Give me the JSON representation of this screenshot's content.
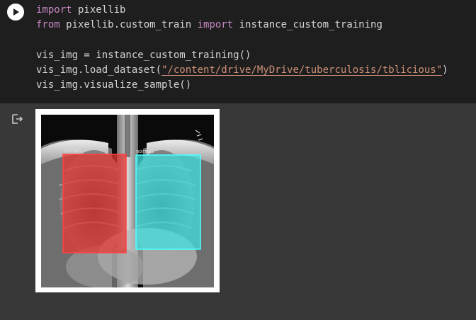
{
  "code_cell": {
    "run_button_icon": "play-icon",
    "lines": [
      [
        {
          "t": "import",
          "c": "kw"
        },
        {
          "t": " pixellib",
          "c": ""
        }
      ],
      [
        {
          "t": "from",
          "c": "kw"
        },
        {
          "t": " pixellib.custom_train ",
          "c": ""
        },
        {
          "t": "import",
          "c": "kw"
        },
        {
          "t": " instance_custom_training",
          "c": ""
        }
      ],
      [],
      [
        {
          "t": "vis_img = instance_custom_training()",
          "c": ""
        }
      ],
      [
        {
          "t": "vis_img.load_dataset(",
          "c": ""
        },
        {
          "t": "\"/content/drive/MyDrive/tuberculosis/tblicious\"",
          "c": "str"
        },
        {
          "t": ")",
          "c": ""
        }
      ],
      [
        {
          "t": "vis_img.visualize_sample()",
          "c": ""
        }
      ]
    ]
  },
  "output": {
    "output_icon": "output-redirect-icon",
    "image": {
      "subject": "chest x-ray",
      "boxes": [
        {
          "label": "normal",
          "color": "#e53935"
        },
        {
          "label": "normal",
          "color": "#40e0e0"
        }
      ]
    }
  },
  "colors": {
    "code_background": "#1e1e1e",
    "output_background": "#383838",
    "keyword": "#c586c0",
    "string": "#ce9178",
    "text": "#d4d4d4"
  }
}
